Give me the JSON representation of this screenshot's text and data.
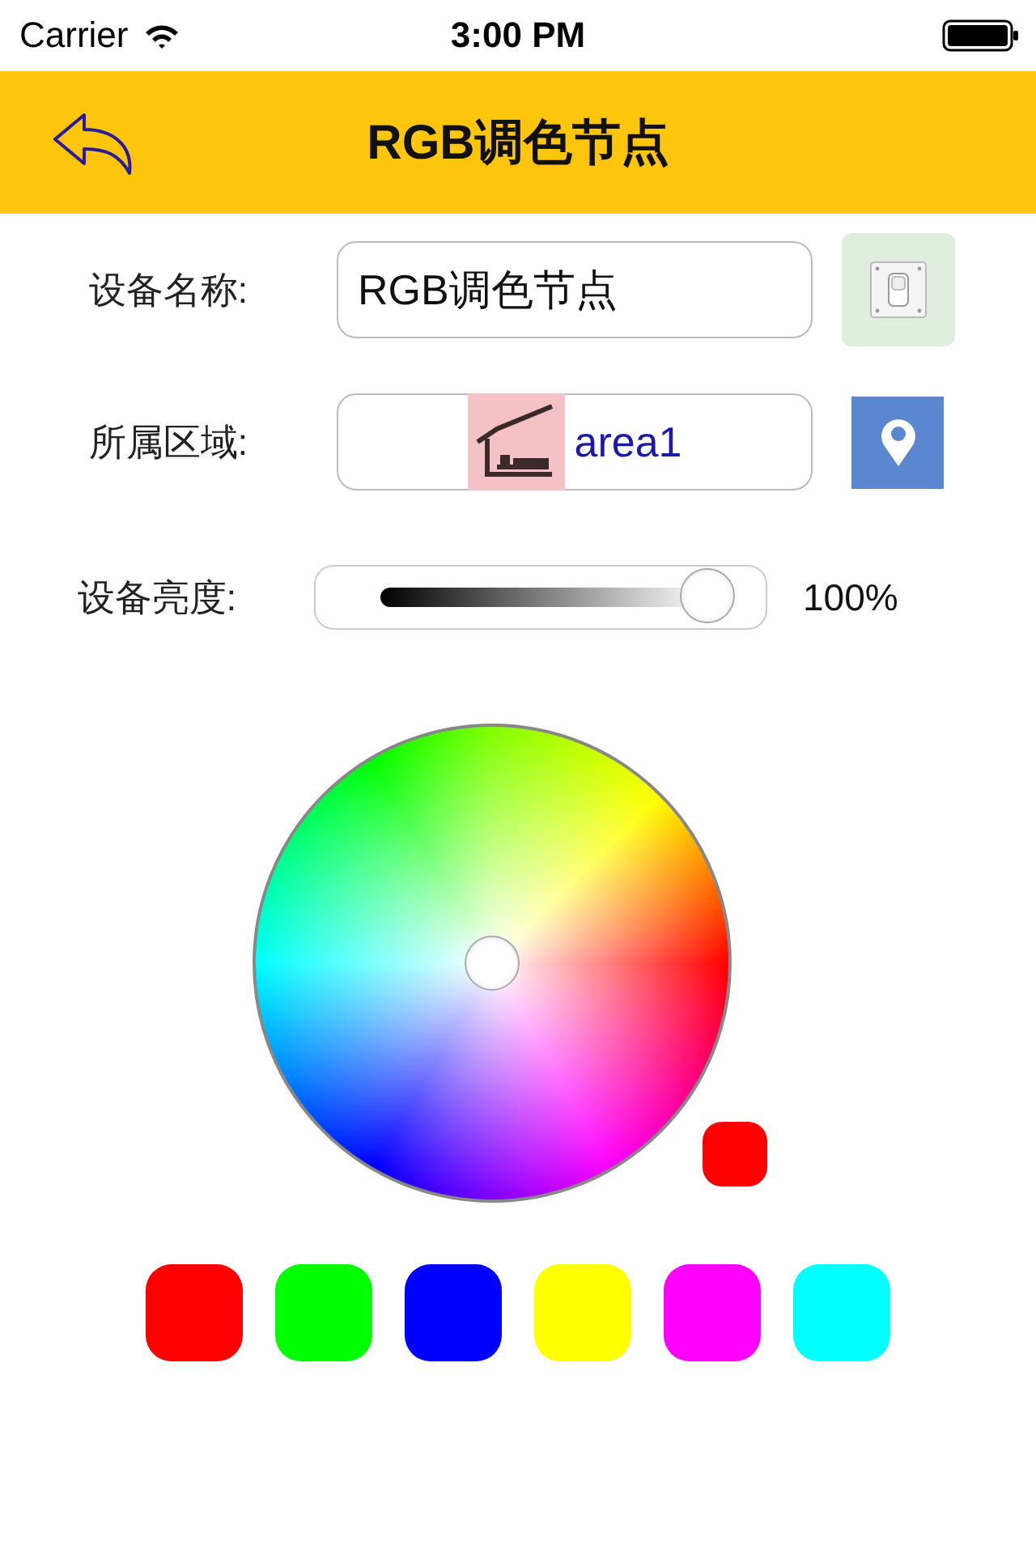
{
  "status_bar": {
    "carrier": "Carrier",
    "time": "3:00 PM"
  },
  "nav_bar": {
    "title": "RGB调色节点"
  },
  "name_row": {
    "label": "设备名称:",
    "value": "RGB调色节点"
  },
  "area_row": {
    "label": "所属区域:",
    "value": "area1"
  },
  "brightness": {
    "label": "设备亮度:",
    "level": 1,
    "reading": "100%"
  },
  "current_color": {
    "color": "#ff0000"
  },
  "swatches": [
    {
      "color": "#ff0000"
    },
    {
      "color": "#00ff00"
    },
    {
      "color": "#0000ff"
    },
    {
      "color": "#ffff00"
    },
    {
      "color": "#ff00ff"
    },
    {
      "color": "#00ffff"
    }
  ]
}
